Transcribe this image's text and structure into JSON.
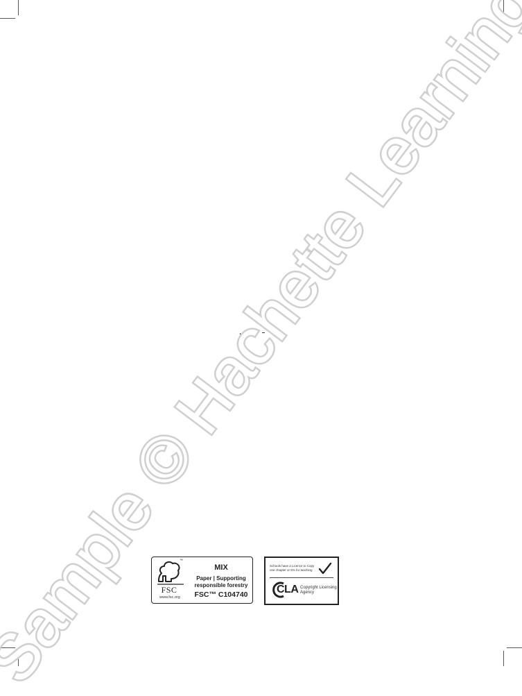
{
  "watermark": {
    "text": "Sample © Hachette Learning"
  },
  "fsc_logo": {
    "brand": "FSC",
    "trademark": "™",
    "url": "www.fsc.org",
    "label_type": "MIX",
    "description": "Paper | Supporting responsible forestry",
    "license_code": "FSC™ C104740"
  },
  "cla_logo": {
    "notice": "Schools have a Licence to Copy one chapter or 5% for teaching",
    "brand": "CLA",
    "agency_name": "Copyright Licensing Agency"
  }
}
